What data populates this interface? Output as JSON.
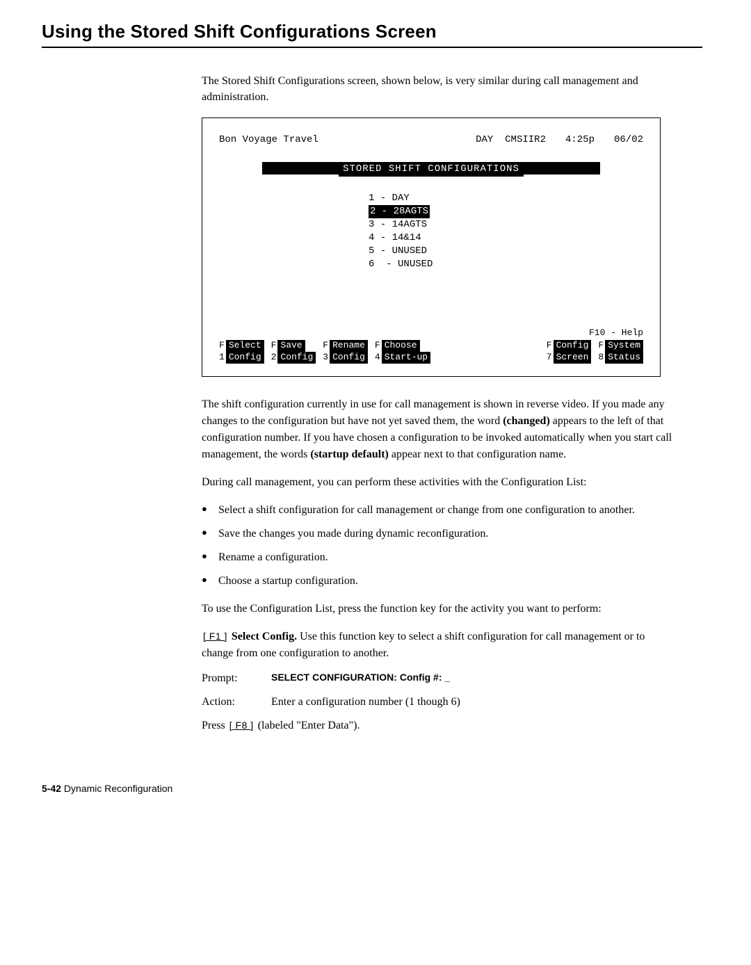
{
  "title": "Using the Stored Shift Configurations Screen",
  "intro": "The Stored Shift Configurations screen, shown below, is very similar during call management and administration.",
  "term": {
    "org": "Bon Voyage Travel",
    "shift": "DAY",
    "sys": "CMSIIR2",
    "time": "4:25p",
    "date": "06/02",
    "bar_label": "STORED SHIFT CONFIGURATIONS",
    "items": [
      {
        "num": "1",
        "name": "DAY",
        "hi": false
      },
      {
        "num": "2",
        "name": "28AGTS",
        "hi": true
      },
      {
        "num": "3",
        "name": "14AGTS",
        "hi": false
      },
      {
        "num": "4",
        "name": "14&14",
        "hi": false
      },
      {
        "num": "5",
        "name": "UNUSED",
        "hi": false
      },
      {
        "num": "6",
        "name": "UNUSED",
        "hi": false
      }
    ],
    "f10": "F10 - Help",
    "fn_left": [
      {
        "pre": "F",
        "top": "Select",
        "n": "1",
        "bot": "Config"
      },
      {
        "pre": "F",
        "top": "Save",
        "n": "2",
        "bot": "Config"
      },
      {
        "pre": "F",
        "top": "Rename",
        "n": "3",
        "bot": "Config"
      },
      {
        "pre": "F",
        "top": "Choose",
        "n": "4",
        "bot": "Start-up"
      }
    ],
    "fn_right": [
      {
        "pre": "F",
        "top": "Config",
        "n": "7",
        "bot": "Screen"
      },
      {
        "pre": "F",
        "top": "System",
        "n": "8",
        "bot": "Status"
      }
    ]
  },
  "paras": {
    "p1a": "The shift configuration currently in use for call management is shown in reverse video. If you made any changes to the configuration but have not yet saved them, the word ",
    "p1b": "(changed)",
    "p1c": " appears to the left of that configuration number. If you have chosen a configuration to be invoked automatically when you start call management, the words ",
    "p1d": "(startup default)",
    "p1e": " appear next to that configuration name.",
    "p2": "During call management, you can perform these activities with the Configuration List:"
  },
  "bullets": [
    "Select a shift configuration for call management or change from one configuration to another.",
    "Save the changes you made during dynamic reconfiguration.",
    "Rename a configuration.",
    "Choose a startup configuration."
  ],
  "p3": "To use the Configuration List, press the function key for the activity you want to perform:",
  "f1": {
    "key": "[ F1 ]",
    "label": "Select Config.",
    "text": " Use this function key to select a shift configuration for call management or to change from one configuration to another."
  },
  "prompt": {
    "label": "Prompt:",
    "value": "SELECT CONFIGURATION: Config #: _"
  },
  "action": {
    "label": "Action:",
    "value": "Enter a configuration number (1 though 6)"
  },
  "press": {
    "a": "Press ",
    "key": "[ F8 ]",
    "b": " (labeled \"Enter Data\")."
  },
  "footer": {
    "page": "5-42",
    "section": "Dynamic Reconfiguration"
  }
}
